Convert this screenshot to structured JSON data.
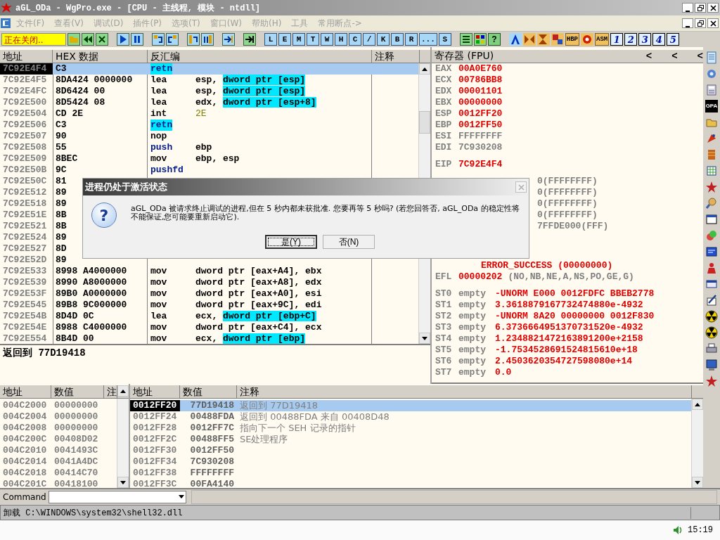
{
  "window": {
    "title": "aGL_ODa - WgPro.exe - [CPU -  主线程, 模块 - ntdll]"
  },
  "menu": [
    {
      "label": "文件(F)",
      "disabled": true
    },
    {
      "label": "查看(V)",
      "disabled": true
    },
    {
      "label": "调试(D)",
      "disabled": true
    },
    {
      "label": "插件(P)",
      "disabled": true
    },
    {
      "label": "选项(T)",
      "disabled": true
    },
    {
      "label": "窗口(W)",
      "disabled": true
    },
    {
      "label": "帮助(H)",
      "disabled": true
    },
    {
      "label": "工具",
      "disabled": true
    },
    {
      "label": "常用断点->",
      "disabled": true
    }
  ],
  "toolbar": {
    "status": "正在关闭..",
    "letter_buttons": [
      "L",
      "E",
      "M",
      "T",
      "W",
      "H",
      "C",
      "/",
      "K",
      "B",
      "R",
      "...",
      "S"
    ],
    "help_button": "?",
    "text_buttons": [
      "HBP",
      "ASM"
    ],
    "number_buttons": [
      "1",
      "2",
      "3",
      "4",
      "5"
    ]
  },
  "disassembly": {
    "columns": [
      "地址",
      "HEX 数据",
      "反汇编",
      "注释"
    ],
    "rows": [
      {
        "address": "7C92E4F4",
        "hex": "C3",
        "op": "retn",
        "kind": "return",
        "op_highlighted": true,
        "selected": true
      },
      {
        "address": "7C92E4F5",
        "hex": "8DA424 0000000",
        "op": "lea",
        "kind": "plain",
        "op_highlighted": false,
        "selected": false,
        "args": [
          {
            "text": "esp, ",
            "kind": "plain"
          },
          {
            "text": "dword ptr [esp]",
            "kind": "highlight"
          }
        ]
      },
      {
        "address": "7C92E4FC",
        "hex": "8D6424 00",
        "op": "lea",
        "kind": "plain",
        "op_highlighted": false,
        "selected": false,
        "args": [
          {
            "text": "esp, ",
            "kind": "plain"
          },
          {
            "text": "dword ptr [esp]",
            "kind": "highlight"
          }
        ]
      },
      {
        "address": "7C92E500",
        "hex": "8D5424 08",
        "op": "lea",
        "kind": "plain",
        "op_highlighted": false,
        "selected": false,
        "args": [
          {
            "text": "edx, ",
            "kind": "plain"
          },
          {
            "text": "dword ptr [esp+8]",
            "kind": "highlight"
          }
        ]
      },
      {
        "address": "7C92E504",
        "hex": "CD 2E",
        "op": "int",
        "kind": "plain",
        "op_highlighted": false,
        "selected": false,
        "args": [
          {
            "text": "2E",
            "kind": "constant"
          }
        ]
      },
      {
        "address": "7C92E506",
        "hex": "C3",
        "op": "retn",
        "kind": "return",
        "op_highlighted": true,
        "selected": false
      },
      {
        "address": "7C92E507",
        "hex": "90",
        "op": "nop",
        "kind": "plain",
        "op_highlighted": false,
        "selected": false
      },
      {
        "address": "7C92E508",
        "hex": "55",
        "op": "push",
        "kind": "stack",
        "op_highlighted": false,
        "selected": false,
        "args": [
          {
            "text": "ebp",
            "kind": "plain"
          }
        ]
      },
      {
        "address": "7C92E509",
        "hex": "8BEC",
        "op": "mov",
        "kind": "plain",
        "op_highlighted": false,
        "selected": false,
        "args": [
          {
            "text": "ebp, esp",
            "kind": "plain"
          }
        ]
      },
      {
        "address": "7C92E50B",
        "hex": "9C",
        "op": "pushfd",
        "kind": "stack",
        "op_highlighted": false,
        "selected": false
      },
      {
        "address": "7C92E50C",
        "hex": "81",
        "selected": false
      },
      {
        "address": "7C92E512",
        "hex": "89",
        "selected": false
      },
      {
        "address": "7C92E518",
        "hex": "89",
        "selected": false
      },
      {
        "address": "7C92E51E",
        "hex": "8B",
        "selected": false
      },
      {
        "address": "7C92E521",
        "hex": "8B",
        "selected": false
      },
      {
        "address": "7C92E524",
        "hex": "89",
        "selected": false
      },
      {
        "address": "7C92E527",
        "hex": "8D",
        "selected": false
      },
      {
        "address": "7C92E52D",
        "hex": "89",
        "selected": false
      },
      {
        "address": "7C92E533",
        "hex": "8998 A4000000",
        "op": "mov",
        "kind": "plain",
        "op_highlighted": false,
        "selected": false,
        "args": [
          {
            "text": "dword ptr [eax+A4], ebx",
            "kind": "plain"
          }
        ]
      },
      {
        "address": "7C92E539",
        "hex": "8990 A8000000",
        "op": "mov",
        "kind": "plain",
        "op_highlighted": false,
        "selected": false,
        "args": [
          {
            "text": "dword ptr [eax+A8], edx",
            "kind": "plain"
          }
        ]
      },
      {
        "address": "7C92E53F",
        "hex": "89B0 A0000000",
        "op": "mov",
        "kind": "plain",
        "op_highlighted": false,
        "selected": false,
        "args": [
          {
            "text": "dword ptr [eax+A0], esi",
            "kind": "plain"
          }
        ]
      },
      {
        "address": "7C92E545",
        "hex": "89B8 9C000000",
        "op": "mov",
        "kind": "plain",
        "op_highlighted": false,
        "selected": false,
        "args": [
          {
            "text": "dword ptr [eax+9C], edi",
            "kind": "plain"
          }
        ]
      },
      {
        "address": "7C92E54B",
        "hex": "8D4D 0C",
        "op": "lea",
        "kind": "plain",
        "op_highlighted": false,
        "selected": false,
        "args": [
          {
            "text": "ecx, ",
            "kind": "plain"
          },
          {
            "text": "dword ptr [ebp+C]",
            "kind": "highlight"
          }
        ]
      },
      {
        "address": "7C92E54E",
        "hex": "8988 C4000000",
        "op": "mov",
        "kind": "plain",
        "op_highlighted": false,
        "selected": false,
        "args": [
          {
            "text": "dword ptr [eax+C4], ecx",
            "kind": "plain"
          }
        ]
      },
      {
        "address": "7C92E554",
        "hex": "8B4D 00",
        "op": "mov",
        "kind": "plain",
        "op_highlighted": false,
        "selected": false,
        "args": [
          {
            "text": "ecx, ",
            "kind": "plain"
          },
          {
            "text": "dword ptr [ebp]",
            "kind": "highlight"
          }
        ]
      }
    ],
    "info": "返回到 77D19418"
  },
  "registers": {
    "title": "寄存器 (FPU)",
    "nav_buttons": [
      "<",
      "<",
      "<"
    ],
    "general": [
      {
        "name": "EAX",
        "value": "00A0E760",
        "changed": true
      },
      {
        "name": "ECX",
        "value": "00786BB8",
        "changed": true
      },
      {
        "name": "EDX",
        "value": "00001101",
        "changed": true
      },
      {
        "name": "EBX",
        "value": "00000000",
        "changed": true
      },
      {
        "name": "ESP",
        "value": "0012FF20",
        "changed": true
      },
      {
        "name": "EBP",
        "value": "0012FF50",
        "changed": true
      },
      {
        "name": "ESI",
        "value": "FFFFFFFF",
        "changed": false
      },
      {
        "name": "EDI",
        "value": "7C930208",
        "changed": false
      }
    ],
    "eip": {
      "name": "EIP",
      "value": "7C92E4F4",
      "changed": true
    },
    "segments": [
      "0(FFFFFFFF)",
      "0(FFFFFFFF)",
      "0(FFFFFFFF)",
      "0(FFFFFFFF)",
      "7FFDE000(FFF)"
    ],
    "last_error": {
      "value": "ERROR_SUCCESS (00000000)",
      "changed": true
    },
    "flags": {
      "name": "EFL",
      "value": "00000202",
      "changed": true,
      "decoded": "(NO,NB,NE,A,NS,PO,GE,G)"
    },
    "fpu": [
      {
        "name": "ST0",
        "tag": "empty",
        "value": "-UNORM E000 0012FDFC BBEB2778",
        "changed": true
      },
      {
        "name": "ST1",
        "tag": "empty",
        "value": "3.3618879167732474880e-4932",
        "changed": true
      },
      {
        "name": "ST2",
        "tag": "empty",
        "value": "-UNORM 8A20 00000000 0012F830",
        "changed": true
      },
      {
        "name": "ST3",
        "tag": "empty",
        "value": "6.3736664951370731520e-4932",
        "changed": true
      },
      {
        "name": "ST4",
        "tag": "empty",
        "value": "1.2348821472163891200e+2158",
        "changed": true
      },
      {
        "name": "ST5",
        "tag": "empty",
        "value": "-1.7534528691524815610e+18",
        "changed": true
      },
      {
        "name": "ST6",
        "tag": "empty",
        "value": "2.4503620354727598080e+14",
        "changed": true
      },
      {
        "name": "ST7",
        "tag": "empty",
        "value": "0.0",
        "changed": true
      }
    ]
  },
  "side_tools": {
    "label_button": "GPA"
  },
  "dump": {
    "columns": [
      "地址",
      "数值",
      "注"
    ],
    "rows": [
      {
        "address": "004C2000",
        "value": "00000000"
      },
      {
        "address": "004C2004",
        "value": "00000000"
      },
      {
        "address": "004C2008",
        "value": "00000000"
      },
      {
        "address": "004C200C",
        "value": "00408D02"
      },
      {
        "address": "004C2010",
        "value": "0041493C"
      },
      {
        "address": "004C2014",
        "value": "0041A4DC"
      },
      {
        "address": "004C2018",
        "value": "00414C70"
      },
      {
        "address": "004C201C",
        "value": "00418100"
      }
    ]
  },
  "stack": {
    "columns": [
      "地址",
      "数值",
      "注释"
    ],
    "rows": [
      {
        "address": "0012FF20",
        "value": "77D19418",
        "comment": "返回到 77D19418",
        "selected": true
      },
      {
        "address": "0012FF24",
        "value": "00488FDA",
        "comment": "返回到 00488FDA 来自 00408D48",
        "selected": false
      },
      {
        "address": "0012FF28",
        "value": "0012FF7C",
        "comment": "指向下一个 SEH 记录的指针",
        "selected": false
      },
      {
        "address": "0012FF2C",
        "value": "00488FF5",
        "comment": "SE处理程序",
        "selected": false
      },
      {
        "address": "0012FF30",
        "value": "0012FF50",
        "selected": false
      },
      {
        "address": "0012FF34",
        "value": "7C930208",
        "selected": false
      },
      {
        "address": "0012FF38",
        "value": "FFFFFFFF",
        "selected": false
      },
      {
        "address": "0012FF3C",
        "value": "00FA4140",
        "selected": false
      }
    ]
  },
  "command": {
    "label": "Command"
  },
  "status_bar": "卸载 C:\\WINDOWS\\system32\\shell32.dll",
  "taskbar": {
    "clock": "15:19"
  },
  "dialog": {
    "title": "进程仍处于激活状态",
    "icon_glyph": "?",
    "message": "aGL_ODa 被请求终止调试的进程,但在 5 秒内都未获批准. 您要再等 5 秒吗? (若您回答否, aGL_ODa 的稳定性将不能保证,您可能要重新启动它).",
    "buttons": [
      {
        "label": "是(Y)",
        "focused": true
      },
      {
        "label": "否(N)",
        "focused": false
      }
    ]
  }
}
